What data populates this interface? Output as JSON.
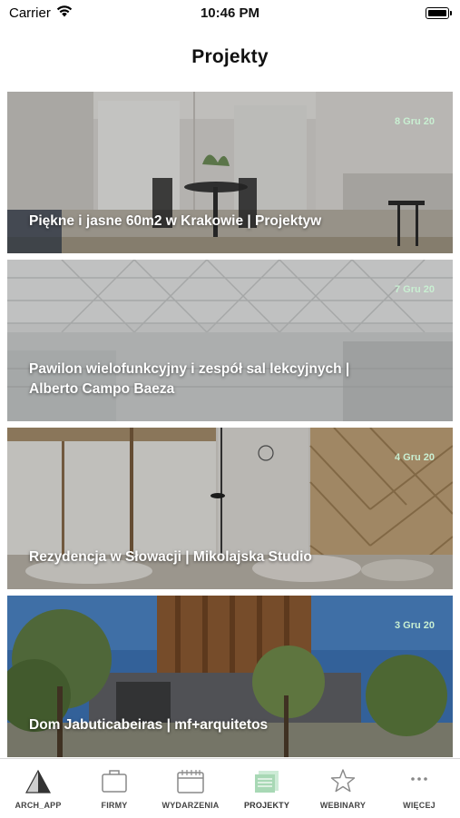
{
  "status_bar": {
    "carrier": "Carrier",
    "time": "10:46 PM"
  },
  "header": {
    "title": "Projekty"
  },
  "projects": [
    {
      "date": "8 Gru 20",
      "title": "Piękne i jasne 60m2 w Krakowie | Projektyw"
    },
    {
      "date": "7 Gru 20",
      "title": "Pawilon wielofunkcyjny i zespół sal lekcyjnych | Alberto Campo Baeza"
    },
    {
      "date": "4 Gru 20",
      "title": "Rezydencja w Słowacji | Mikolajska Studio"
    },
    {
      "date": "3 Gru 20",
      "title": "Dom Jabuticabeiras | mf+arquitetos"
    }
  ],
  "tabbar": {
    "active_color": "#a8d8b5",
    "items": [
      {
        "label": "ARCH_APP",
        "icon": "arch-logo-icon"
      },
      {
        "label": "FIRMY",
        "icon": "briefcase-icon"
      },
      {
        "label": "WYDARZENIA",
        "icon": "calendar-icon"
      },
      {
        "label": "PROJEKTY",
        "icon": "documents-icon",
        "active": true
      },
      {
        "label": "WEBINARY",
        "icon": "star-icon"
      },
      {
        "label": "WIĘCEJ",
        "icon": "more-icon"
      }
    ]
  }
}
